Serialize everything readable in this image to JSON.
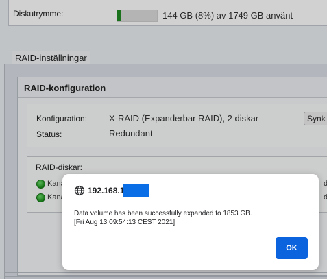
{
  "disk_usage": {
    "label": "Diskutrymme:",
    "used_fraction": 0.08,
    "summary": "144 GB (8%) av 1749 GB använt",
    "bar_color": "#1f8a22"
  },
  "tabs": [
    {
      "label": "RAID-inställningar",
      "active": true
    }
  ],
  "raid_config": {
    "title": "RAID-konfiguration",
    "config_label": "Konfiguration:",
    "config_value": "X-RAID (Expanderbar RAID), 2 diskar",
    "status_label": "Status:",
    "status_value": "Redundant",
    "sync_button_label": "Synk"
  },
  "raid_disks": {
    "label": "RAID-diskar:",
    "rows": [
      {
        "text": "Kana",
        "trailing": "d",
        "status_color": "#1b8f1b"
      },
      {
        "text": "Kana",
        "trailing": "d",
        "status_color": "#1b8f1b"
      }
    ]
  },
  "dialog": {
    "origin": "192.168.1",
    "icon": "globe-icon",
    "message_line1": "Data volume has been successfully expanded to 1853 GB.",
    "message_line2": "[Fri Aug 13 09:54:13 CEST 2021]",
    "ok_label": "OK",
    "accent_color": "#0b63de"
  }
}
